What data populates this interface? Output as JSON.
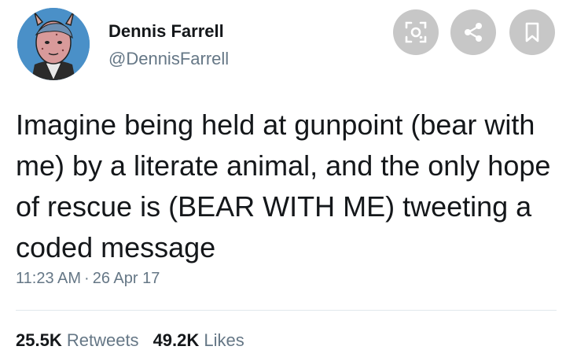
{
  "author": {
    "display_name": "Dennis Farrell",
    "handle": "@DennisFarrell"
  },
  "actions": [
    {
      "icon": "lens-icon"
    },
    {
      "icon": "share-icon"
    },
    {
      "icon": "bookmark-icon"
    }
  ],
  "tweet": {
    "text": "Imagine being held at gunpoint (bear with me) by a literate animal, and the only hope of rescue is (BEAR WITH ME) tweeting a coded message",
    "time": "11:23 AM",
    "separator": "·",
    "date": "26 Apr 17"
  },
  "stats": {
    "retweets_count": "25.5K",
    "retweets_label": "Retweets",
    "likes_count": "49.2K",
    "likes_label": "Likes"
  },
  "colors": {
    "text": "#14171a",
    "secondary": "#657786",
    "action_button_bg": "#c7c7c7",
    "divider": "#e1e8ed"
  }
}
